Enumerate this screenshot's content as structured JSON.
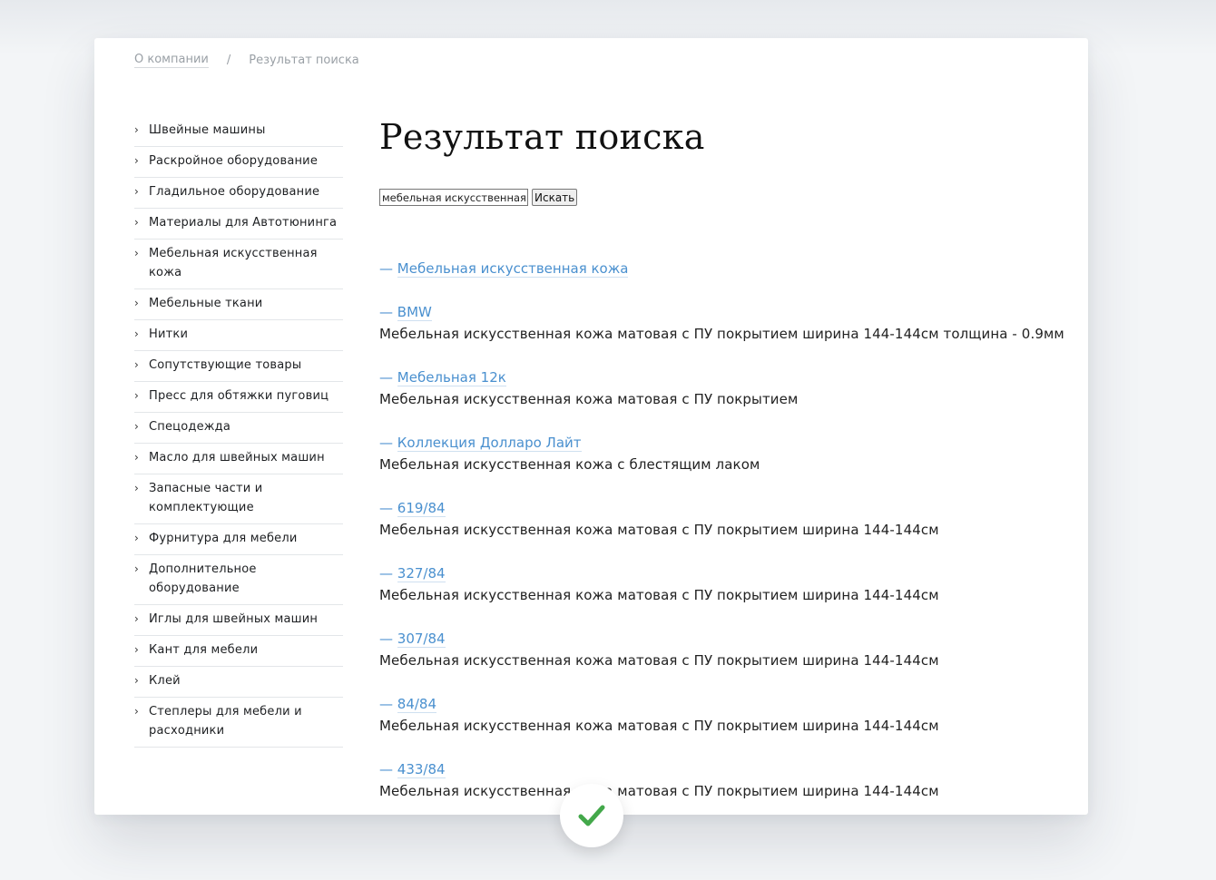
{
  "breadcrumb": {
    "home": "О компании",
    "separator": "/",
    "current": "Результат поиска"
  },
  "sidebar": {
    "items": [
      {
        "label": "Швейные машины"
      },
      {
        "label": "Раскройное оборудование"
      },
      {
        "label": "Гладильное оборудование"
      },
      {
        "label": "Материалы для Автотюнинга"
      },
      {
        "label": "Мебельная искусственная кожа"
      },
      {
        "label": "Мебельные ткани"
      },
      {
        "label": "Нитки"
      },
      {
        "label": "Сопутствующие товары"
      },
      {
        "label": "Пресс для обтяжки пуговиц"
      },
      {
        "label": "Спецодежда"
      },
      {
        "label": "Масло для швейных машин"
      },
      {
        "label": "Запасные части и комплектующие"
      },
      {
        "label": "Фурнитура для мебели"
      },
      {
        "label": "Дополнительное оборудование"
      },
      {
        "label": "Иглы для швейных машин"
      },
      {
        "label": "Кант для мебели"
      },
      {
        "label": "Клей"
      },
      {
        "label": "Степлеры для мебели и расходники"
      }
    ],
    "chevron": "›"
  },
  "main": {
    "title": "Результат поиска",
    "search": {
      "value": "мебельная искусственная кожа",
      "button_label": "Искать"
    },
    "dash": "—",
    "results": [
      {
        "title": "Мебельная искусственная кожа",
        "description": ""
      },
      {
        "title": "BMW",
        "description": "Мебельная искусственная кожа матовая с ПУ покрытием ширина 144-144см толщина - 0.9мм"
      },
      {
        "title": "Мебельная 12к",
        "description": "Мебельная искусственная кожа матовая с ПУ покрытием"
      },
      {
        "title": "Коллекция Долларо Лайт",
        "description": "Мебельная искусственная кожа с блестящим лаком"
      },
      {
        "title": "619/84",
        "description": "Мебельная искусственная кожа матовая с ПУ покрытием ширина 144-144см"
      },
      {
        "title": "327/84",
        "description": "Мебельная искусственная кожа матовая с ПУ покрытием ширина 144-144см"
      },
      {
        "title": "307/84",
        "description": "Мебельная искусственная кожа матовая с ПУ покрытием ширина 144-144см"
      },
      {
        "title": "84/84",
        "description": "Мебельная искусственная кожа матовая с ПУ покрытием ширина 144-144см"
      },
      {
        "title": "433/84",
        "description": "Мебельная искусственная кожа матовая с ПУ покрытием ширина 144-144см"
      }
    ]
  },
  "badge": {
    "icon": "checkmark-icon",
    "color": "#43a84a"
  }
}
